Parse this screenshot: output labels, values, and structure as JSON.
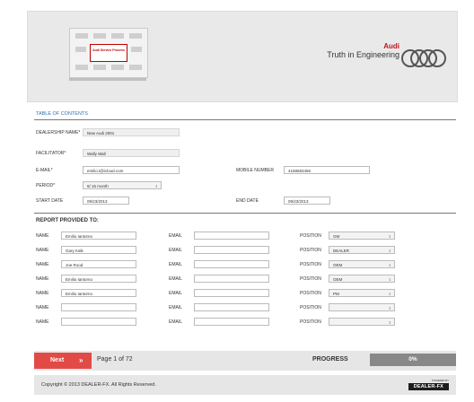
{
  "brand": {
    "name": "Audi",
    "tagline": "Truth in Engineering",
    "thumb_text": "Audi Service Process"
  },
  "toc": "TABLE OF CONTENTS",
  "form": {
    "dealership_label": "DEALERSHIP NAME*",
    "dealership_value": "New Audi 2001",
    "facilitator_label": "FACILITATOR*",
    "facilitator_value": "Wally Wall",
    "email_label": "E-MAIL*",
    "email_value": "emilio.t@icloud.com",
    "mobile_label": "MOBILE NUMBER",
    "mobile_value": "4168683456",
    "period_label": "PERIOD*",
    "period_value": "6/ 15 month",
    "start_label": "START DATE",
    "start_value": "09/23/2013",
    "end_label": "END DATE",
    "end_value": "09/23/2013"
  },
  "report": {
    "title": "REPORT PROVIDED TO:",
    "name_label": "NAME",
    "email_label": "EMAIL",
    "position_label": "POSITION",
    "rows": [
      {
        "name": "Emilio Iantorno",
        "email": "",
        "position": "GM"
      },
      {
        "name": "Gary Kalk",
        "email": "",
        "position": "DEALER"
      },
      {
        "name": "Joe Rood",
        "email": "",
        "position": "OEM"
      },
      {
        "name": "Emilio Iantorno",
        "email": "",
        "position": "OEM"
      },
      {
        "name": "Emilio Iantorno",
        "email": "",
        "position": "PM"
      },
      {
        "name": "",
        "email": "",
        "position": ""
      },
      {
        "name": "",
        "email": "",
        "position": ""
      }
    ]
  },
  "nav": {
    "next": "Next",
    "chevron": "»",
    "page": "Page 1 of 72",
    "progress_label": "PROGRESS",
    "progress_value": "0%",
    "progress_fraction": 0
  },
  "footer": {
    "copyright": "Copyright © 2013 DEALER-FX. All Rights Reserved.",
    "powered_by": "POWERED BY",
    "logo": "DEALER-FX"
  },
  "icons": {
    "select_arrow": "up-down-caret-icon",
    "next_chevron": "double-chevron-right-icon"
  },
  "colors": {
    "next": "#e24a45",
    "toc": "#2a72b5",
    "brand_red": "#c0141e",
    "progress": "#888888"
  }
}
